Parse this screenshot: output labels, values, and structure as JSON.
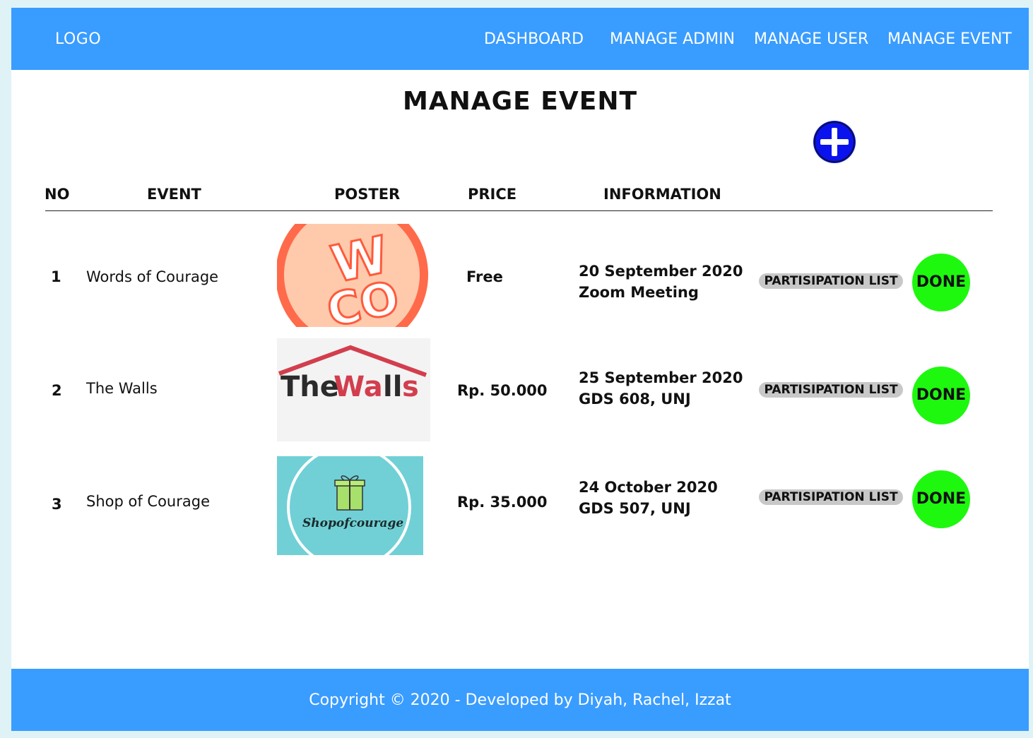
{
  "nav": {
    "logo": "LOGO",
    "items": [
      "DASHBOARD",
      "MANAGE ADMIN",
      "MANAGE USER",
      "MANAGE EVENT"
    ]
  },
  "page_title": "MANAGE EVENT",
  "add_icon": "plus-circle-icon",
  "table": {
    "headers": [
      "NO",
      "EVENT",
      "POSTER",
      "PRICE",
      "INFORMATION"
    ],
    "rows": [
      {
        "no": "1",
        "event": "Words of Courage",
        "poster_text": [
          "W",
          "CO"
        ],
        "price": "Free",
        "date": "20 September 2020",
        "location": "Zoom Meeting",
        "list_label": "PARTISIPATION LIST",
        "done_label": "DONE"
      },
      {
        "no": "2",
        "event": "The Walls",
        "poster_text": [
          "The",
          "Wa",
          "ll",
          "s"
        ],
        "price": "Rp. 50.000",
        "date": "25 September 2020",
        "location": "GDS 608, UNJ",
        "list_label": "PARTISIPATION LIST",
        "done_label": "DONE"
      },
      {
        "no": "3",
        "event": "Shop  of Courage",
        "poster_text": [
          "Shopofcourage"
        ],
        "price": "Rp. 35.000",
        "date": "24 October 2020",
        "location": "GDS 507, UNJ",
        "list_label": "PARTISIPATION LIST",
        "done_label": "DONE"
      }
    ]
  },
  "colors": {
    "nav_bg": "#399cff",
    "done_bg": "#1ef80f",
    "add_bg": "#0a12ee",
    "pill_bg": "#c8c8c8"
  },
  "footer": "Copyright © 2020 - Developed by Diyah, Rachel, Izzat"
}
